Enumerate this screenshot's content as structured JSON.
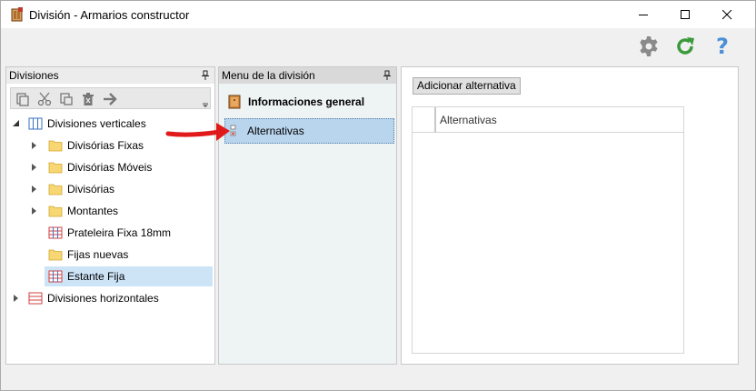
{
  "window": {
    "title": "División - Armarios constructor",
    "minimize_label": "",
    "maximize_label": "",
    "close_label": ""
  },
  "top_toolbar": {
    "settings_icon": "gear-icon",
    "refresh_icon": "refresh-icon",
    "help_label": "?"
  },
  "divisions_panel": {
    "title": "Divisiones",
    "toolbar_icons": [
      "copy-icon",
      "cut-icon",
      "paste-icon",
      "delete-icon",
      "arrow-right-icon"
    ],
    "tree": [
      {
        "label": "Divisiones verticales",
        "icon": "vertical-divisions-icon",
        "expanded": true
      },
      {
        "label": "Divisórias Fixas",
        "icon": "folder-icon"
      },
      {
        "label": "Divisórias Móveis",
        "icon": "folder-icon"
      },
      {
        "label": "Divisórias",
        "icon": "folder-icon"
      },
      {
        "label": "Montantes",
        "icon": "folder-icon"
      },
      {
        "label": "Prateleira Fixa 18mm",
        "icon": "grid-icon"
      },
      {
        "label": "Fijas nuevas",
        "icon": "folder-icon"
      },
      {
        "label": "Estante Fija",
        "icon": "grid-icon",
        "selected": true
      },
      {
        "label": "Divisiones horizontales",
        "icon": "horizontal-divisions-icon",
        "expanded": false
      }
    ]
  },
  "menu_panel": {
    "title": "Menu de la división",
    "items": [
      {
        "label": "Informaciones general",
        "bold": true
      },
      {
        "label": "Alternativas",
        "active": true
      }
    ]
  },
  "right_panel": {
    "add_button": "Adicionar alternativa",
    "grid_column": "Alternativas"
  },
  "colors": {
    "selection": "#cde4f7",
    "menu_active": "#b9d5ee",
    "refresh_green": "#3a9a3a",
    "help_blue": "#4a90d6",
    "arrow_red": "#e01a1a"
  }
}
